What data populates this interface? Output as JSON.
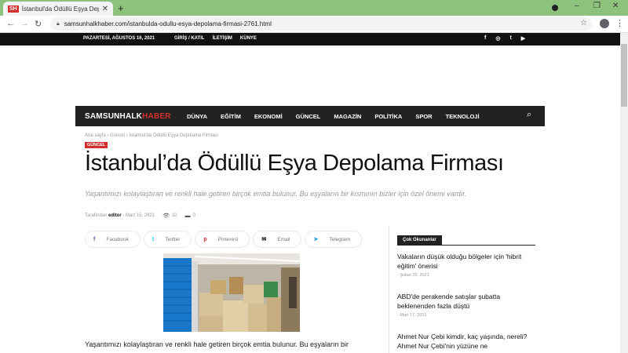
{
  "browser": {
    "tab_favicon": "SH",
    "tab_title": "İstanbul'da Ödüllü Eşya Depolam",
    "url": "samsunhalkhaber.com/istanbulda-odullu-esya-depolama-firmasi-2761.html"
  },
  "topbar": {
    "date": "PAZARTESİ, AĞUSTOS 16, 2021",
    "links": [
      "GİRİŞ / KATIL",
      "İLETİŞİM",
      "KÜNYE"
    ]
  },
  "logo": {
    "main": "SAMSUNHALK",
    "accent": "HABER",
    "accent_color": "#d32f2f"
  },
  "nav": [
    "DÜNYA",
    "EĞİTİM",
    "EKONOMİ",
    "GÜNCEL",
    "MAGAZİN",
    "POLİTİKA",
    "SPOR",
    "TEKNOLOJİ"
  ],
  "article": {
    "breadcrumb": [
      "Ana sayfa",
      "Güncel",
      "İstanbul'da Ödüllü Eşya Depolama Firması"
    ],
    "category": "GÜNCEL",
    "title": "İstanbul’da Ödüllü Eşya Depolama Firması",
    "subtitle": "Yaşantımızı kolaylaştıran ve renkli hale getiren birçok emtia bulunur. Bu eşyaların bir kısmının bizler için özel önemi vardır.",
    "author_prefix": "Tarafından",
    "author": "editor",
    "date": "Mart 15, 2021",
    "views": "32",
    "comments": "0",
    "body_start": "Yaşantımızı kolaylaştıran ve renkli hale getiren birçok emtia bulunur. Bu eşyaların bir"
  },
  "share": [
    {
      "label": "Facebook",
      "icon": "f",
      "color": "#516eab"
    },
    {
      "label": "Twitter",
      "icon": "t",
      "color": "#29c5f6"
    },
    {
      "label": "Pinterest",
      "icon": "p",
      "color": "#ca212a"
    },
    {
      "label": "Email",
      "icon": "envelope",
      "color": "#000000"
    },
    {
      "label": "Telegram",
      "icon": "plane",
      "color": "#179cde"
    }
  ],
  "popular": {
    "title": "Çok Okunanlar",
    "items": [
      {
        "title": "Vakaların düşük olduğu bölgeler için 'hibrit eğitim' önerisi",
        "date": "Şubat 25, 2021"
      },
      {
        "title": "ABD'de perakende satışlar şubatta beklenenden fazla düştü",
        "date": "Mart 17, 2021"
      },
      {
        "title": "Ahmet Nur Çebi kimdir, kaç yaşında, nereli? Ahmet Nur Çebi'nin yüzüne ne",
        "date": ""
      }
    ]
  }
}
